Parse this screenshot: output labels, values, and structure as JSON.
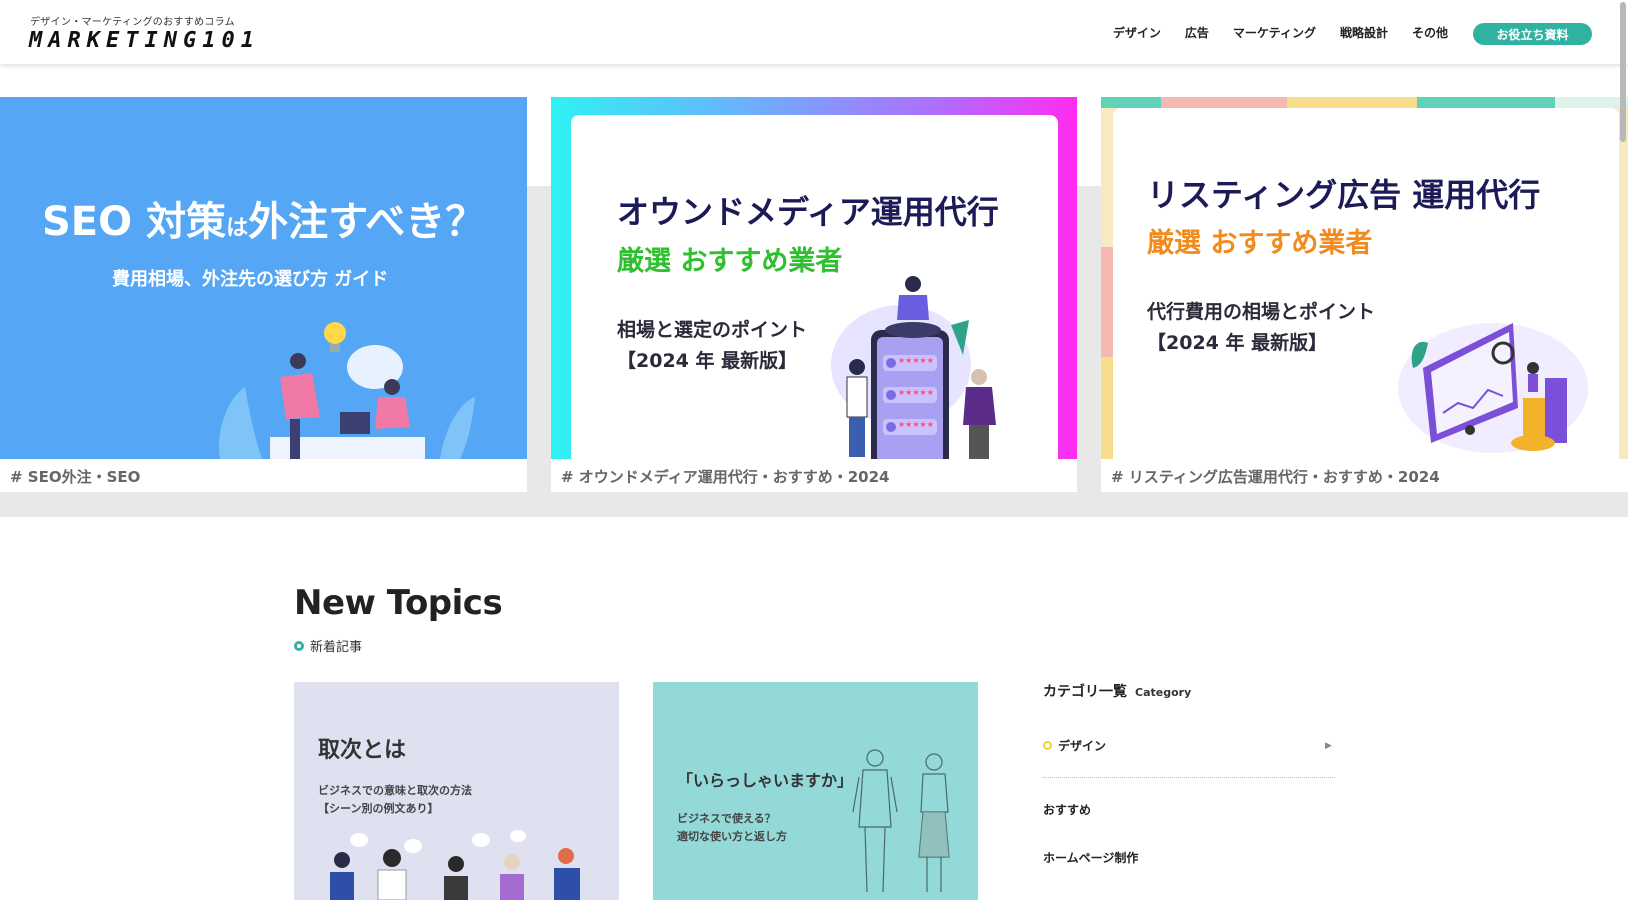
{
  "header": {
    "tagline": "デザイン・マーケティングのおすすめコラム",
    "logo": "MARKETING101",
    "nav": [
      "デザイン",
      "広告",
      "マーケティング",
      "戦略設計",
      "その他"
    ],
    "cta": "お役立ち資料"
  },
  "hero": {
    "cards": [
      {
        "title_a": "SEO 対策",
        "title_small": "は",
        "title_b": "外注すべき？",
        "subtitle": "費用相場、外注先の選び方 ガイド",
        "tag": "# SEO外注・SEO"
      },
      {
        "title": "オウンドメディア運用代行",
        "highlight": "厳選 おすすめ業者",
        "line1": "相場と選定のポイント",
        "line2": "【2024 年 最新版】",
        "stars": "★★★★★",
        "tag": "# オウンドメディア運用代行・おすすめ・2024"
      },
      {
        "title": "リスティング広告 運用代行",
        "highlight": "厳選 おすすめ業者",
        "line1": "代行費用の相場とポイント",
        "line2": "【2024 年 最新版】",
        "tag": "# リスティング広告運用代行・おすすめ・2024"
      }
    ]
  },
  "topics": {
    "title": "New Topics",
    "subtitle": "新着記事",
    "articles": [
      {
        "title": "取次とは",
        "desc1": "ビジネスでの意味と取次の方法",
        "desc2": "【シーン別の例文あり】"
      },
      {
        "title": "「いらっしゃいますか」",
        "desc1": "ビジネスで使える？",
        "desc2": "適切な使い方と返し方"
      }
    ]
  },
  "sidebar": {
    "heading": "カテゴリ一覧",
    "heading_en": "Category",
    "items": [
      "デザイン",
      "おすすめ",
      "ホームページ制作"
    ],
    "arrow": "▶"
  },
  "colors": {
    "accent": "#2fb3a0",
    "hero_blue": "#55a7f5",
    "green_highlight": "#2fbf2f",
    "orange_highlight": "#f28a1c",
    "navy_text": "#1d1b57"
  }
}
